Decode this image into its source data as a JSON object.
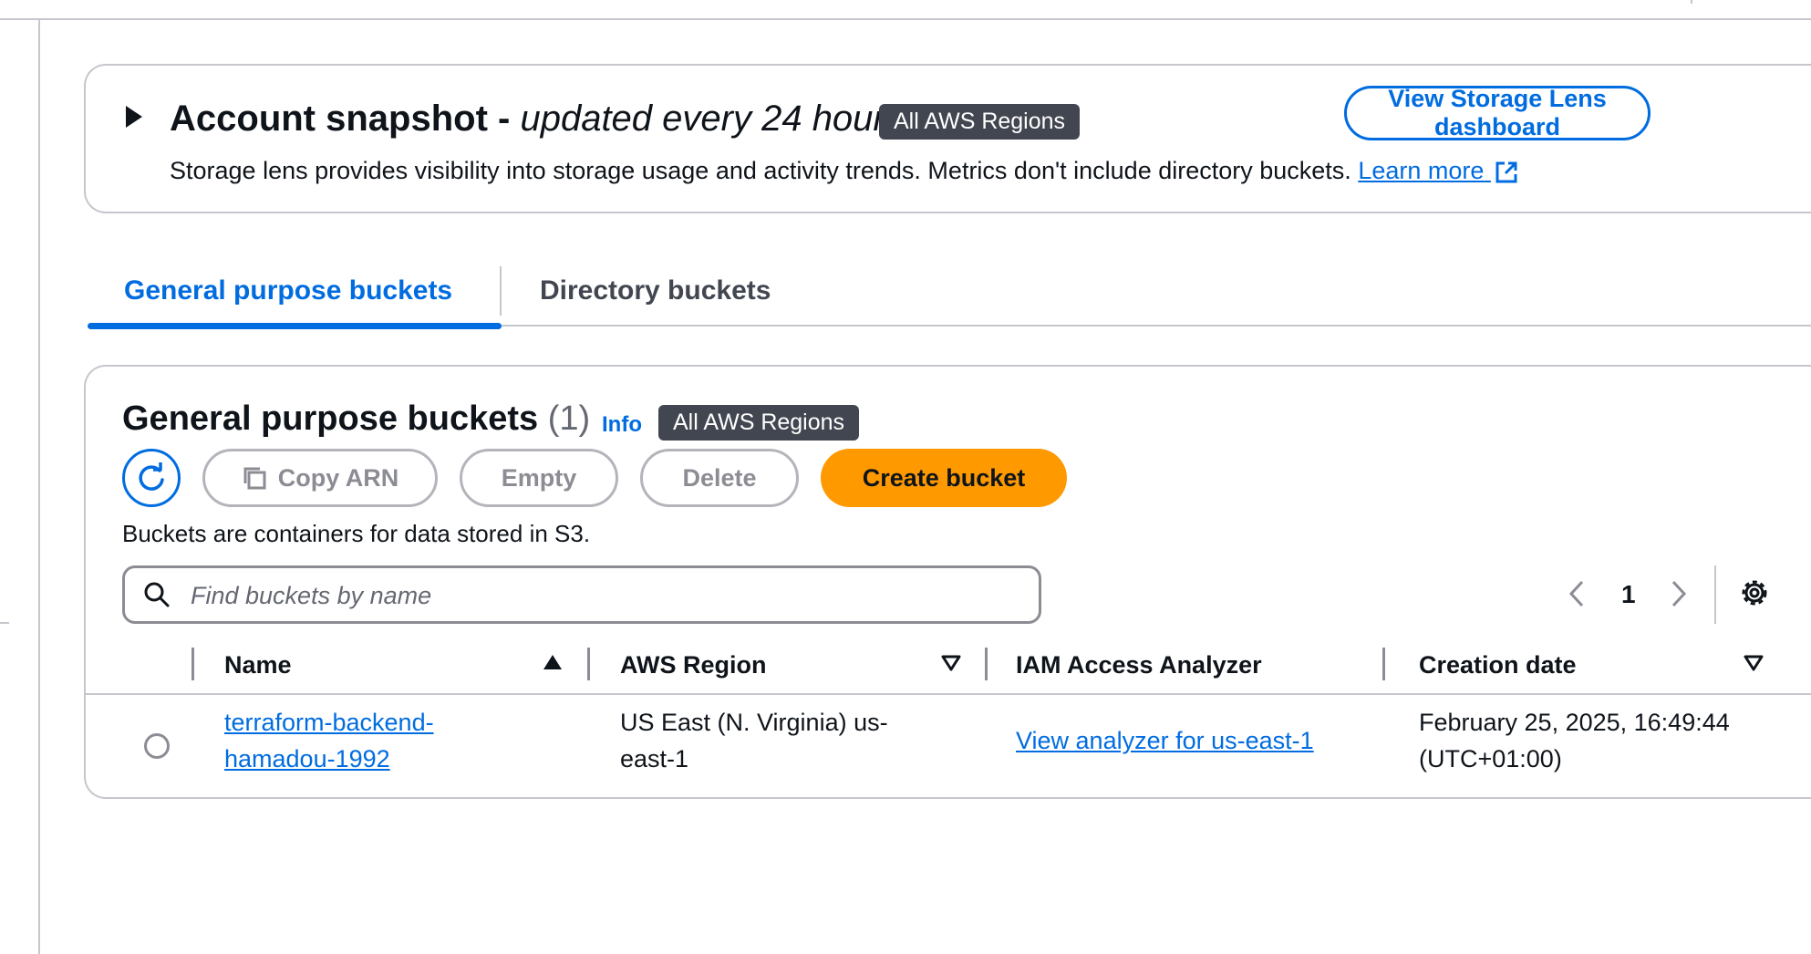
{
  "snapshot": {
    "title_main": "Account snapshot - ",
    "title_italic": "updated every 24 hours",
    "region_badge": "All AWS Regions",
    "description": "Storage lens provides visibility into storage usage and activity trends. Metrics don't include directory buckets.",
    "learn_more": "Learn more",
    "lens_button": "View Storage Lens dashboard"
  },
  "tabs": [
    {
      "label": "General purpose buckets",
      "active": true
    },
    {
      "label": "Directory buckets",
      "active": false
    }
  ],
  "buckets": {
    "title": "General purpose buckets",
    "count": "(1)",
    "info": "Info",
    "region_badge": "All AWS Regions",
    "actions": {
      "copy_arn": "Copy ARN",
      "empty": "Empty",
      "delete": "Delete",
      "create": "Create bucket"
    },
    "description": "Buckets are containers for data stored in S3.",
    "search_placeholder": "Find buckets by name",
    "page": "1",
    "columns": [
      "Name",
      "AWS Region",
      "IAM Access Analyzer",
      "Creation date"
    ],
    "rows": [
      {
        "name": "terraform-backend-hamadou-1992",
        "region": "US East (N. Virginia) us-east-1",
        "iam": "View analyzer for us-east-1",
        "created": "February 25, 2025, 16:49:44 (UTC+01:00)"
      }
    ]
  },
  "colors": {
    "link": "#006ce0",
    "primary_button": "#ff9900",
    "badge": "#424650",
    "border": "#c6c6cd"
  },
  "icons": [
    "caret-right-icon",
    "external-link-icon",
    "refresh-icon",
    "copy-icon",
    "search-icon",
    "chevron-left-icon",
    "chevron-right-icon",
    "gear-icon",
    "sort-ascending-icon",
    "sort-descending-icon"
  ]
}
